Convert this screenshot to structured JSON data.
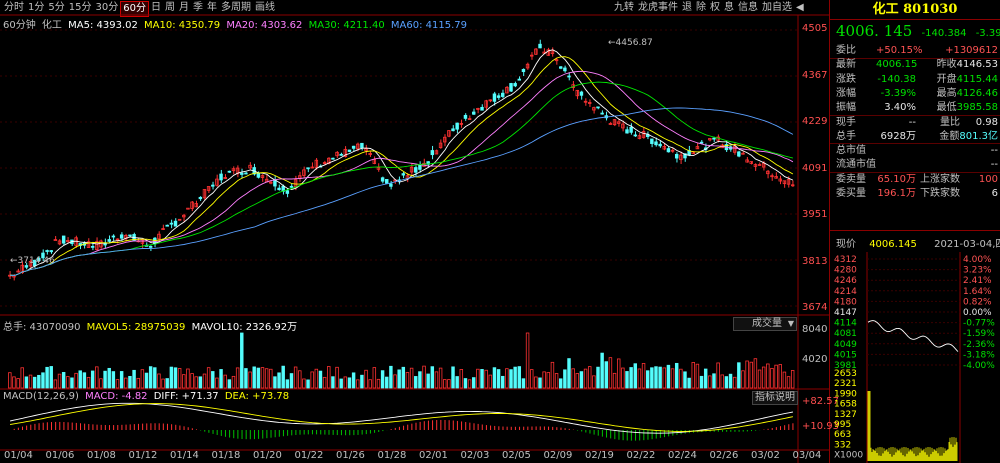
{
  "toolbar": {
    "periods": [
      "分时",
      "1分",
      "5分",
      "15分",
      "30分",
      "60分",
      "日",
      "周",
      "月",
      "季",
      "年",
      "多周期",
      "画线"
    ],
    "active_period": "60分",
    "right_items": [
      "九转",
      "龙虎事件",
      "退",
      "除",
      "权",
      "息",
      "信息",
      "加自选"
    ]
  },
  "ma_legend": {
    "period": "60分钟",
    "name": "化工",
    "ma5": "MA5: 4393.02",
    "ma10": "MA10: 4350.79",
    "ma20": "MA20: 4303.62",
    "ma30": "MA30: 4211.40",
    "ma60": "MA60: 4115.79"
  },
  "price_axis": [
    "4505",
    "4367",
    "4229",
    "4091",
    "3951",
    "3813",
    "3674"
  ],
  "annotations": {
    "high": "4456.87",
    "low": "3714.46"
  },
  "volume_legend": {
    "total": "总手: 43070090",
    "mavol5": "MAVOL5: 28975039",
    "mavol10": "MAVOL10: 2326.92万",
    "dropdown": "成交量"
  },
  "volume_axis": [
    "8040",
    "4020"
  ],
  "macd_legend": {
    "name": "MACD(12,26,9)",
    "macd": "MACD: -4.82",
    "diff": "DIFF: +71.37",
    "dea": "DEA: +73.78",
    "explain": "指标说明"
  },
  "macd_axis": [
    "+82.57",
    "+10.93"
  ],
  "x_axis": [
    "01/04",
    "01/06",
    "01/08",
    "01/12",
    "01/14",
    "01/18",
    "01/20",
    "01/22",
    "01/26",
    "01/28",
    "02/01",
    "02/03",
    "02/05",
    "02/09",
    "02/19",
    "02/22",
    "02/24",
    "02/26",
    "03/02",
    "03/04"
  ],
  "sidebar": {
    "title": "化工 801030",
    "price": "4006. 145",
    "change": "-140.384",
    "change_pct": "-3.39%",
    "rows": [
      {
        "l": "委比",
        "v1": "+50.15%",
        "v2": "+1309612",
        "c1": "red",
        "c2": "red"
      },
      {
        "l": "最新",
        "v1": "4006.15",
        "l2": "昨收",
        "v2": "4146.53",
        "c1": "green",
        "c2": "white"
      },
      {
        "l": "涨跌",
        "v1": "-140.38",
        "l2": "开盘",
        "v2": "4115.44",
        "c1": "green",
        "c2": "green"
      },
      {
        "l": "涨幅",
        "v1": "-3.39%",
        "l2": "最高",
        "v2": "4126.46",
        "c1": "green",
        "c2": "green"
      },
      {
        "l": "振幅",
        "v1": "3.40%",
        "l2": "最低",
        "v2": "3985.58",
        "c1": "white",
        "c2": "green"
      },
      {
        "l": "现手",
        "v1": "--",
        "l2": "量比",
        "v2": "0.98",
        "c1": "white",
        "c2": "white"
      },
      {
        "l": "总手",
        "v1": "6928万",
        "l2": "金额",
        "v2": "801.3亿",
        "c1": "white",
        "c2": "cyan"
      },
      {
        "l": "总市值",
        "v1": "",
        "l2": "",
        "v2": "--",
        "c1": "white",
        "c2": "white"
      },
      {
        "l": "流通市值",
        "v1": "",
        "l2": "",
        "v2": "--",
        "c1": "white",
        "c2": "white"
      },
      {
        "l": "委卖量",
        "v1": "65.10万",
        "l2": "上涨家数",
        "v2": "100",
        "c1": "red",
        "c2": "red"
      },
      {
        "l": "委买量",
        "v1": "196.1万",
        "l2": "下跌家数",
        "v2": "6",
        "c1": "red",
        "c2": "white"
      }
    ],
    "now_label": "现价",
    "now_value": "4006.145",
    "now_date": "2021-03-04,四",
    "mini_prices": [
      "4312",
      "4280",
      "4246",
      "4214",
      "4180",
      "4147",
      "4114",
      "4081",
      "4049",
      "4015",
      "3981"
    ],
    "mini_pcts": [
      "4.00%",
      "3.23%",
      "2.41%",
      "1.64%",
      "0.82%",
      "0.00%",
      "-0.77%",
      "-1.59%",
      "-2.36%",
      "-3.18%",
      "-4.00%"
    ],
    "mini_vol": [
      "2653",
      "2321",
      "1990",
      "1658",
      "1327",
      "995",
      "663",
      "332",
      "X1000"
    ]
  },
  "colors": {
    "up": "#ff3232",
    "down": "#54fcfc",
    "ma5": "#ffffff",
    "ma10": "#ffff00",
    "ma20": "#ff80ff",
    "ma30": "#00e600",
    "ma60": "#5aa0ff",
    "border": "#8b0000"
  }
}
